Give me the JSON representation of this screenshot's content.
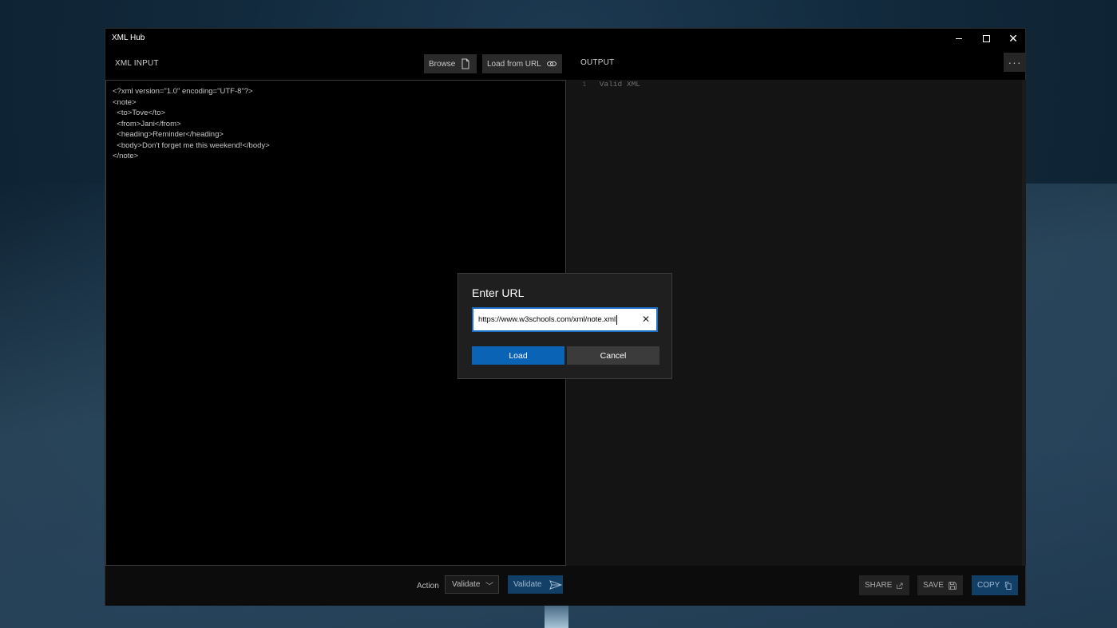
{
  "window": {
    "title": "XML Hub"
  },
  "input_panel": {
    "label": "XML INPUT",
    "browse_label": "Browse",
    "load_url_label": "Load from URL",
    "lines": [
      "<?xml version=\"1.0\" encoding=\"UTF-8\"?>",
      "<note>",
      "  <to>Tove</to>",
      "  <from>Jani</from>",
      "  <heading>Reminder</heading>",
      "  <body>Don't forget me this weekend!</body>",
      "</note>"
    ]
  },
  "output_panel": {
    "label": "OUTPUT",
    "more_label": "···",
    "line_number": "1",
    "text": "Valid XML"
  },
  "bottom_bar": {
    "action_label": "Action",
    "action_value": "Validate",
    "validate_label": "Validate",
    "share_label": "SHARE",
    "save_label": "SAVE",
    "copy_label": "COPY"
  },
  "dialog": {
    "title": "Enter URL",
    "url_value": "https://www.w3schools.com/xml/note.xml",
    "load_label": "Load",
    "cancel_label": "Cancel"
  },
  "colors": {
    "accent": "#0a63b5",
    "window_bg": "#000000",
    "output_bg": "#141414"
  }
}
